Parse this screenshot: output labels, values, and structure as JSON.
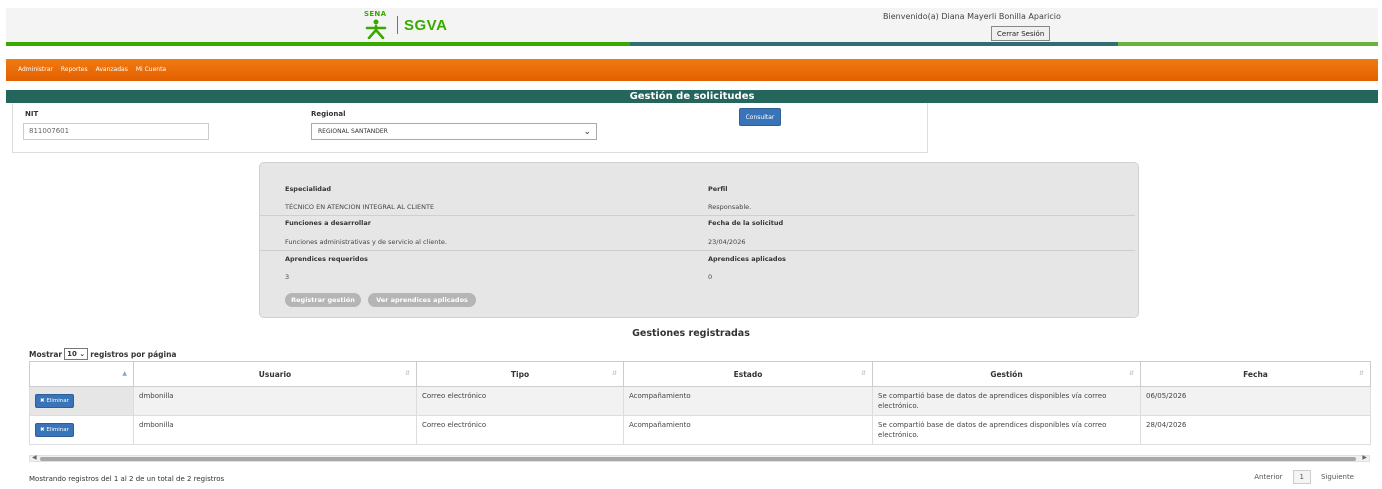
{
  "header": {
    "brand_mark": "SENA",
    "brand_name": "SGVA",
    "welcome": "Bienvenido(a) Diana Mayerli Bonilla Aparicio",
    "logout_label": "Cerrar Sesión",
    "colors": {
      "green": "#39a900",
      "teal": "#24655c",
      "orange": "#e45f00"
    }
  },
  "nav": {
    "items": [
      "Administrar",
      "Reportes",
      "Avanzadas",
      "Mi Cuenta"
    ]
  },
  "page_title": "Gestión de solicitudes",
  "filters": {
    "nit_label": "NIT",
    "nit_value": "811007601",
    "regional_label": "Regional",
    "regional_value": "REGIONAL SANTANDER",
    "consultar_label": "Consultar"
  },
  "detail": {
    "especialidad_label": "Especialidad",
    "especialidad_value": "TÉCNICO EN ATENCION INTEGRAL AL CLIENTE",
    "perfil_label": "Perfil",
    "perfil_value": "Responsable.",
    "funciones_label": "Funciones a desarrollar",
    "funciones_value": "Funciones administrativas y de servicio al cliente.",
    "fecha_label": "Fecha de la solicitud",
    "fecha_value": "23/04/2026",
    "requeridos_label": "Aprendices requeridos",
    "requeridos_value": "3",
    "aplicados_label": "Aprendices aplicados",
    "aplicados_value": "0",
    "registrar_label": "Registrar gestión",
    "ver_label": "Ver aprendices aplicados"
  },
  "gestiones": {
    "title": "Gestiones registradas",
    "length_prefix": "Mostrar",
    "length_value": "10",
    "length_suffix": "registros por página",
    "columns": [
      "",
      "Usuario",
      "Tipo",
      "Estado",
      "Gestión",
      "Fecha"
    ],
    "delete_label": "Eliminar",
    "rows": [
      {
        "usuario": "dmbonilla",
        "tipo": "Correo electrónico",
        "estado": "Acompañamiento",
        "gestion": "Se compartió base de datos de aprendices disponibles vía correo electrónico.",
        "fecha": "06/05/2026"
      },
      {
        "usuario": "dmbonilla",
        "tipo": "Correo electrónico",
        "estado": "Acompañamiento",
        "gestion": "Se compartió base de datos de aprendices disponibles vía correo electrónico.",
        "fecha": "28/04/2026"
      }
    ],
    "info": "Mostrando registros del 1 al 2 de un total de 2 registros",
    "pager": {
      "prev": "Anterior",
      "current": "1",
      "next": "Siguiente"
    }
  }
}
